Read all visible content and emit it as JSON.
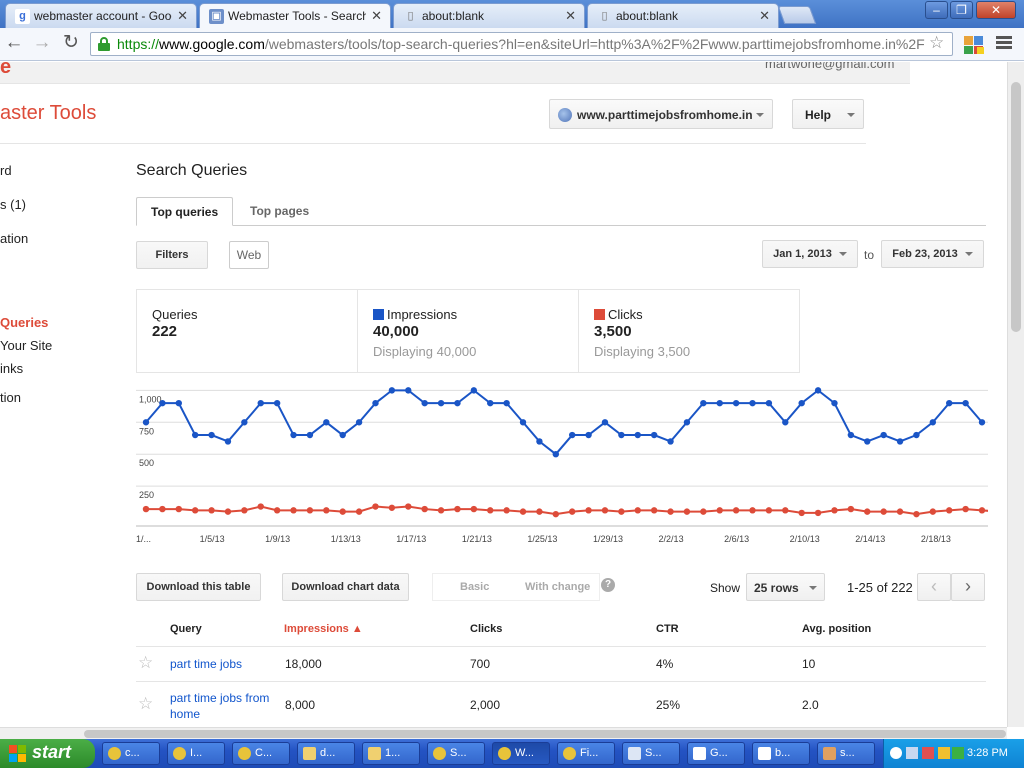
{
  "browser": {
    "tabs": [
      {
        "label": "webmaster account - Google",
        "icon": "google-favicon",
        "active": false
      },
      {
        "label": "Webmaster Tools - Search Q",
        "icon": "webmaster-tools-favicon",
        "active": true
      },
      {
        "label": "about:blank",
        "icon": "page-icon",
        "active": false
      },
      {
        "label": "about:blank",
        "icon": "page-icon",
        "active": false
      }
    ],
    "url": {
      "scheme": "https://",
      "host": "www.google.com",
      "path": "/webmasters/tools/top-search-queries?hl=en&siteUrl=http%3A%2F%2Fwww.parttimejobsfromhome.in%2F"
    }
  },
  "header": {
    "logo_fragment": "e",
    "account": "martwone@gmail.com",
    "product_name": "aster Tools",
    "site": "www.parttimejobsfromhome.in",
    "help_label": "Help"
  },
  "sidebar": {
    "items": [
      {
        "label": "rd",
        "active": false
      },
      {
        "label": "s (1)",
        "active": false
      },
      {
        "label": "ation",
        "active": false
      },
      {
        "label": "Queries",
        "active": true
      },
      {
        "label": "Your Site",
        "active": false
      },
      {
        "label": "inks",
        "active": false
      },
      {
        "label": "tion",
        "active": false
      }
    ]
  },
  "main": {
    "title": "Search Queries",
    "tabs": [
      {
        "label": "Top queries",
        "active": true
      },
      {
        "label": "Top pages",
        "active": false
      }
    ],
    "filters_label": "Filters",
    "web_chip": "Web",
    "date_from": "Jan 1, 2013",
    "date_to_label": "to",
    "date_to": "Feb 23, 2013"
  },
  "stats": {
    "queries": {
      "label": "Queries",
      "value": "222"
    },
    "impressions": {
      "label": "Impressions",
      "value": "40,000",
      "sub": "Displaying 40,000",
      "color": "#1a55c6"
    },
    "clicks": {
      "label": "Clicks",
      "value": "3,500",
      "sub": "Displaying 3,500",
      "color": "#dd4b39"
    }
  },
  "chart_data": {
    "type": "line",
    "y_ticks": [
      "1,000",
      "750",
      "500",
      "250"
    ],
    "y_tick_values": [
      1000,
      750,
      500,
      250
    ],
    "x_labels": [
      "1/...",
      "1/5/13",
      "1/9/13",
      "1/13/13",
      "1/17/13",
      "1/21/13",
      "1/25/13",
      "1/29/13",
      "2/2/13",
      "2/6/13",
      "2/10/13",
      "2/14/13",
      "2/18/13"
    ],
    "x_label_index": [
      0,
      4,
      8,
      12,
      16,
      20,
      24,
      28,
      32,
      36,
      40,
      44,
      48
    ],
    "ylim": [
      0,
      1050
    ],
    "grid": true,
    "legend": "none",
    "series": [
      {
        "name": "Impressions",
        "color": "#1a55c6",
        "values": [
          750,
          900,
          900,
          650,
          650,
          600,
          750,
          900,
          900,
          650,
          650,
          750,
          650,
          750,
          900,
          1000,
          1000,
          900,
          900,
          900,
          1000,
          900,
          900,
          750,
          600,
          500,
          650,
          650,
          750,
          650,
          650,
          650,
          600,
          750,
          900,
          900,
          900,
          900,
          900,
          750,
          900,
          1000,
          900,
          650,
          600,
          650,
          600,
          650,
          750,
          900,
          900,
          750
        ]
      },
      {
        "name": "Clicks",
        "color": "#dd4b39",
        "values": [
          70,
          70,
          70,
          60,
          60,
          50,
          60,
          90,
          60,
          60,
          60,
          60,
          50,
          50,
          90,
          80,
          90,
          70,
          60,
          70,
          70,
          60,
          60,
          50,
          50,
          30,
          50,
          60,
          60,
          50,
          60,
          60,
          50,
          50,
          50,
          60,
          60,
          60,
          60,
          60,
          40,
          40,
          60,
          70,
          50,
          50,
          50,
          30,
          50,
          60,
          70,
          60,
          50
        ]
      }
    ]
  },
  "toolbar": {
    "download_table": "Download this table",
    "download_chart": "Download chart data",
    "basic": "Basic",
    "with_change": "With change",
    "show_label": "Show",
    "rows_select": "25 rows",
    "range": "1-25 of 222",
    "prev": "‹",
    "next": "›"
  },
  "table": {
    "headers": [
      "Query",
      "Impressions ▲",
      "Clicks",
      "CTR",
      "Avg. position"
    ],
    "rows": [
      {
        "query": "part time jobs",
        "impressions": "18,000",
        "clicks": "700",
        "ctr": "4%",
        "position": "10"
      },
      {
        "query": "part time jobs from home",
        "impressions": "8,000",
        "clicks": "2,000",
        "ctr": "25%",
        "position": "2.0"
      }
    ]
  },
  "taskbar": {
    "start_label": "start",
    "tasks": [
      {
        "label": "c...",
        "icon": "chrome-icon"
      },
      {
        "label": "I...",
        "icon": "chrome-icon"
      },
      {
        "label": "C...",
        "icon": "chrome-icon"
      },
      {
        "label": "d...",
        "icon": "folder-icon"
      },
      {
        "label": "1...",
        "icon": "folder-icon"
      },
      {
        "label": "S...",
        "icon": "chrome-icon"
      },
      {
        "label": "W...",
        "icon": "chrome-icon",
        "active": true
      },
      {
        "label": "Fi...",
        "icon": "chrome-icon"
      },
      {
        "label": "S...",
        "icon": "document-icon"
      },
      {
        "label": "G...",
        "icon": "chat-icon"
      },
      {
        "label": "b...",
        "icon": "chat-icon"
      },
      {
        "label": "s...",
        "icon": "app-icon"
      }
    ],
    "clock": "3:28 PM"
  }
}
